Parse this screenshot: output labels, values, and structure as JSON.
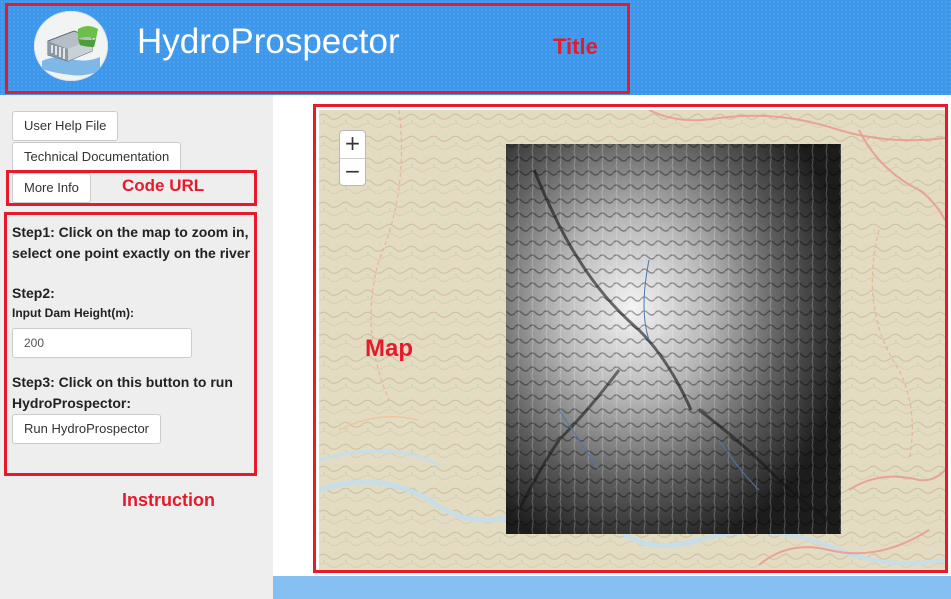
{
  "header": {
    "app_title": "HydroProspector",
    "logo_icon": "dam-logo-icon"
  },
  "annotations": {
    "title": "Title",
    "code_url": "Code URL",
    "map": "Map",
    "instruction": "Instruction"
  },
  "sidebar": {
    "user_help_file": "User Help File",
    "technical_documentation": "Technical Documentation",
    "more_info": "More Info"
  },
  "instructions": {
    "step1_line1": "Step1: Click on the map to zoom in,",
    "step1_line2": "select one point exactly on the river",
    "step2": "Step2:",
    "dam_height_label": "Input Dam Height(m):",
    "dam_height_value": "200",
    "step3_line1": "Step3: Click on this button to run",
    "step3_line2": "HydroProspector:",
    "run_button": "Run HydroProspector"
  },
  "map": {
    "zoom_in": "+",
    "zoom_out": "−"
  },
  "colors": {
    "header": "#3d97ea",
    "annotation": "#e61a2a",
    "sidebar": "#eeeeee"
  }
}
